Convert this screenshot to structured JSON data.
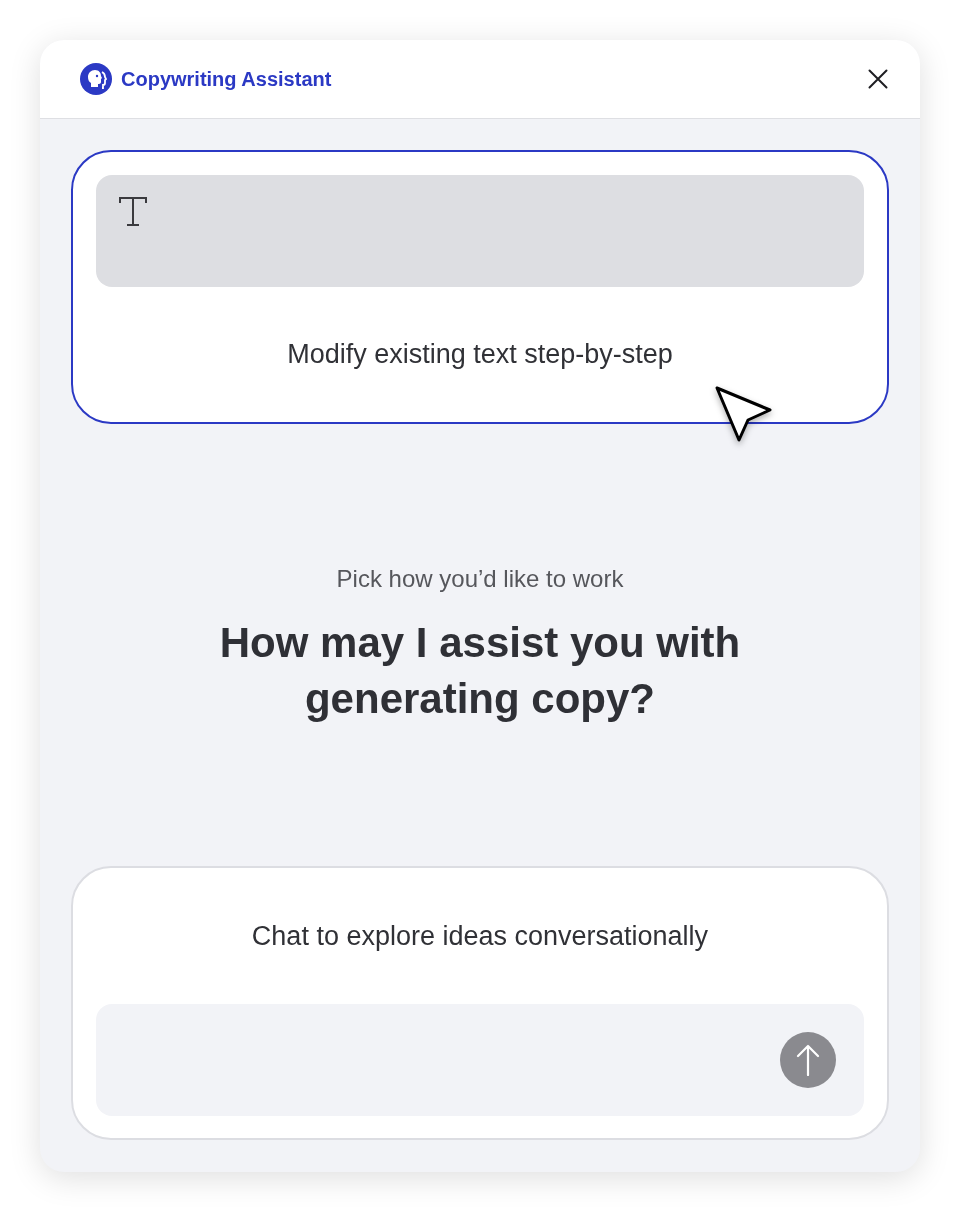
{
  "window": {
    "title": "Copywriting Assistant"
  },
  "edit_option": {
    "label": "Modify existing text step-by-step",
    "selected": true
  },
  "intro": {
    "subtitle": "Pick how you’d like to work",
    "heading": "How may I assist you with generating copy?"
  },
  "chat_option": {
    "label": "Chat to explore ideas conversationally",
    "selected": false
  }
}
